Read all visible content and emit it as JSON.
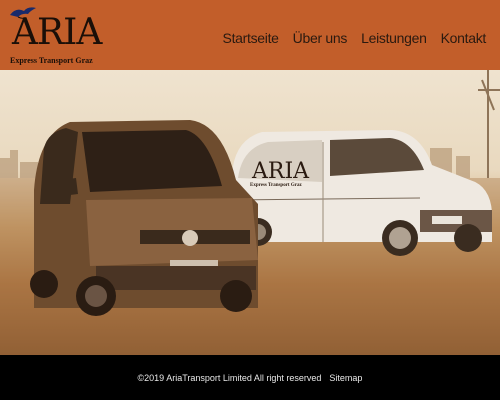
{
  "brand": {
    "name": "ARIA",
    "tagline": "Express Transport Graz",
    "header_color": "#c25e2a"
  },
  "nav": {
    "items": [
      {
        "label": "Startseite"
      },
      {
        "label": "Über uns"
      },
      {
        "label": "Leistungen"
      },
      {
        "label": "Kontakt"
      }
    ]
  },
  "hero": {
    "van_logo_text": "ARIA",
    "van_logo_sub": "Express Transport Graz",
    "slides_total": 2,
    "slide_active": 2
  },
  "footer": {
    "copyright": "©2019 AriaTransport Limited All right reserved",
    "sitemap_label": "Sitemap"
  }
}
